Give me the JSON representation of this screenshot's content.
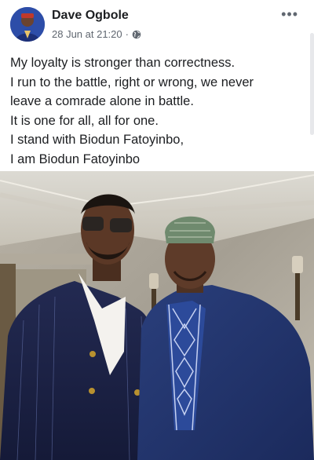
{
  "post": {
    "author": "Dave Ogbole",
    "timestamp": "28 Jun at 21:20",
    "separator": "·",
    "privacy_icon": "globe-icon",
    "menu_icon": "more-options-icon",
    "more_label": "•••",
    "text_lines": [
      "My loyalty is stronger than correctness.",
      "I run to the battle, right or wrong, we never",
      "leave a comrade alone in battle.",
      "It is one for all, all for one.",
      "I stand with Biodun Fatoyinbo,",
      "I am Biodun Fatoyinbo"
    ]
  },
  "colors": {
    "author_text": "#1c1e21",
    "meta_text": "#606770",
    "avatar_bg": "#1f3c8e"
  }
}
